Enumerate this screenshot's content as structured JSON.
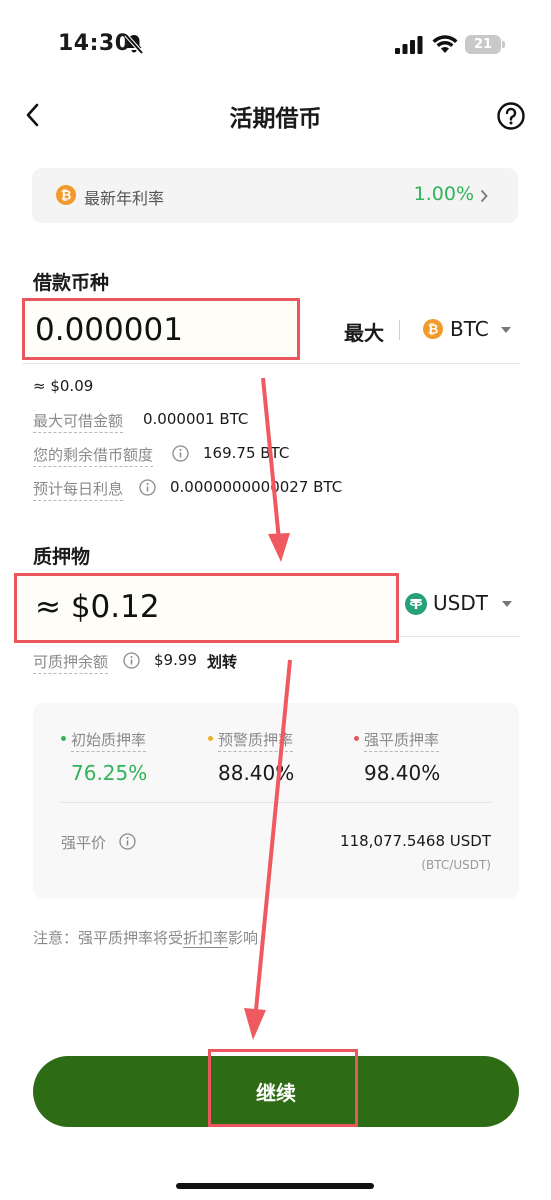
{
  "status_bar": {
    "time": "14:30",
    "battery": "21"
  },
  "header": {
    "title": "活期借币"
  },
  "rate_banner": {
    "label": "最新年利率",
    "value": "1.00%"
  },
  "borrow": {
    "section_label": "借款币种",
    "amount": "0.000001",
    "max_label": "最大",
    "coin": "BTC",
    "usd_value": "≈ $0.09",
    "max_borrow_label": "最大可借金额",
    "max_borrow_value": "0.000001 BTC",
    "remaining_label": "您的剩余借币额度",
    "remaining_value": "169.75 BTC",
    "daily_interest_label": "预计每日利息",
    "daily_interest_value": "0.0000000000027 BTC"
  },
  "collateral": {
    "section_label": "质押物",
    "amount": "≈ $0.12",
    "coin": "USDT",
    "available_label": "可质押余额",
    "available_value": "$9.99",
    "transfer_label": "划转"
  },
  "ratios": {
    "initial": {
      "label": "初始质押率",
      "value": "76.25%",
      "color": "#2fb45a"
    },
    "warning": {
      "label": "预警质押率",
      "value": "88.40%",
      "color": "#e8b22a"
    },
    "liquidation": {
      "label": "强平质押率",
      "value": "98.40%",
      "color": "#e25563"
    },
    "liq_price_label": "强平价",
    "liq_price_value": "118,077.5468 USDT",
    "liq_price_pair": "(BTC/USDT)"
  },
  "note": {
    "prefix": "注意：强平质押率将受",
    "link": "折扣率",
    "suffix": "影响"
  },
  "continue_label": "继续",
  "colors": {
    "accent_green": "#2fb45a",
    "button_green": "#2e6b15",
    "highlight_red": "#e9565c",
    "btc_orange": "#f39a2c",
    "usdt_teal": "#26a17b"
  }
}
